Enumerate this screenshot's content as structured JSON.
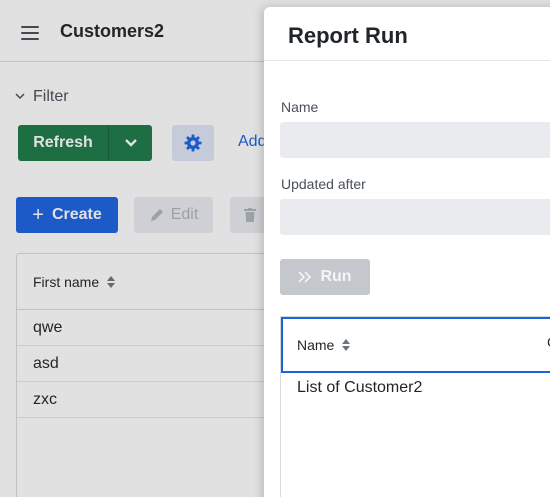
{
  "app": {
    "title": "Customers2"
  },
  "filter": {
    "label": "Filter"
  },
  "toolbar": {
    "refresh_label": "Refresh",
    "add_label": "Add",
    "create_label": "Create",
    "edit_label": "Edit"
  },
  "grid": {
    "column_header": "First name",
    "rows": [
      "qwe",
      "asd",
      "zxc"
    ]
  },
  "dialog": {
    "title": "Report Run",
    "name_label": "Name",
    "name_value": "",
    "updated_after_label": "Updated after",
    "updated_after_value": "",
    "run_label": "Run",
    "results": {
      "column_header": "Name",
      "second_column_header": "C",
      "rows": [
        "List of Customer2"
      ]
    }
  },
  "colors": {
    "refresh_green": "#1b7a45",
    "primary_blue": "#1a62e0",
    "disabled_gray": "#c4c8cd"
  },
  "icons": [
    "menu-icon",
    "chevron-down-icon",
    "gear-icon",
    "plus-icon",
    "pencil-icon",
    "trash-icon",
    "sort-icon",
    "double-chevron-right-icon"
  ]
}
